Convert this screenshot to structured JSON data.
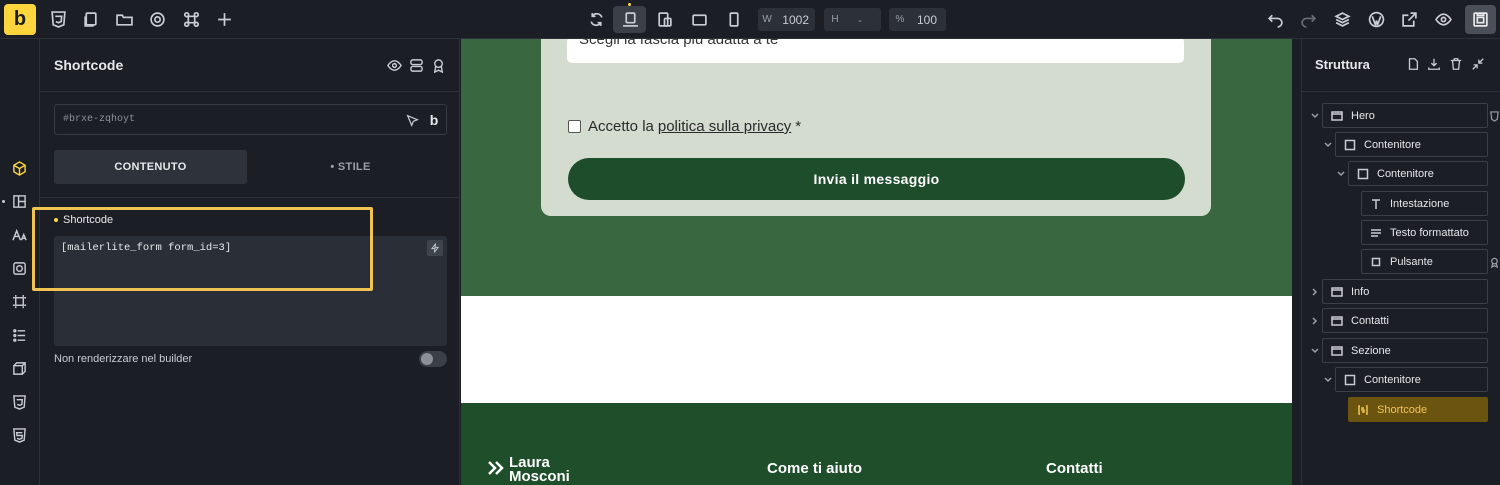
{
  "toolbar": {
    "logo": "b",
    "width_label": "W",
    "width_value": "1002",
    "height_label": "H",
    "height_value": "-",
    "zoom_label": "%",
    "zoom_value": "100"
  },
  "panel": {
    "title": "Shortcode",
    "element_id": "#brxe-zqhoyt",
    "brand_glyph": "b",
    "tabs": [
      {
        "label": "CONTENUTO",
        "active": true
      },
      {
        "label": "• STILE",
        "active": false
      }
    ],
    "field_label": "Shortcode",
    "shortcode_value": "[mailerlite_form form_id=3]",
    "toggle_label": "Non renderizzare nel builder",
    "toggle_on": false
  },
  "canvas": {
    "select_text": "Scegli la fascia più adatta a te",
    "checkbox_prefix": "Accetto la",
    "checkbox_link": "politica sulla privacy",
    "checkbox_suffix": "*",
    "submit_label": "Invia il messaggio",
    "footer_logo_line1": "Laura",
    "footer_logo_line2": "Mosconi",
    "footer_col1": "Come ti aiuto",
    "footer_col2": "Contatti"
  },
  "structure": {
    "title": "Struttura",
    "items": [
      {
        "label": "Hero",
        "icon": "section-icon",
        "level": 0
      },
      {
        "label": "Contenitore",
        "icon": "container-icon",
        "level": 1
      },
      {
        "label": "Contenitore",
        "icon": "container-icon",
        "level": 2
      },
      {
        "label": "Intestazione",
        "icon": "heading-icon",
        "level": 3
      },
      {
        "label": "Testo formattato",
        "icon": "text-icon",
        "level": 3
      },
      {
        "label": "Pulsante",
        "icon": "button-icon",
        "level": 3
      },
      {
        "label": "Info",
        "icon": "section-icon",
        "level": 0
      },
      {
        "label": "Contatti",
        "icon": "section-icon",
        "level": 0
      },
      {
        "label": "Sezione",
        "icon": "section-icon",
        "level": 0
      },
      {
        "label": "Contenitore",
        "icon": "container-icon",
        "level": 1
      },
      {
        "label": "Shortcode",
        "icon": "shortcode-icon",
        "level": 2,
        "active": true
      }
    ]
  },
  "colors": {
    "accent": "#ffd53e",
    "canvas_green": "#39673f",
    "button_green": "#1d4d2a",
    "card_bg": "#d3dccf"
  }
}
